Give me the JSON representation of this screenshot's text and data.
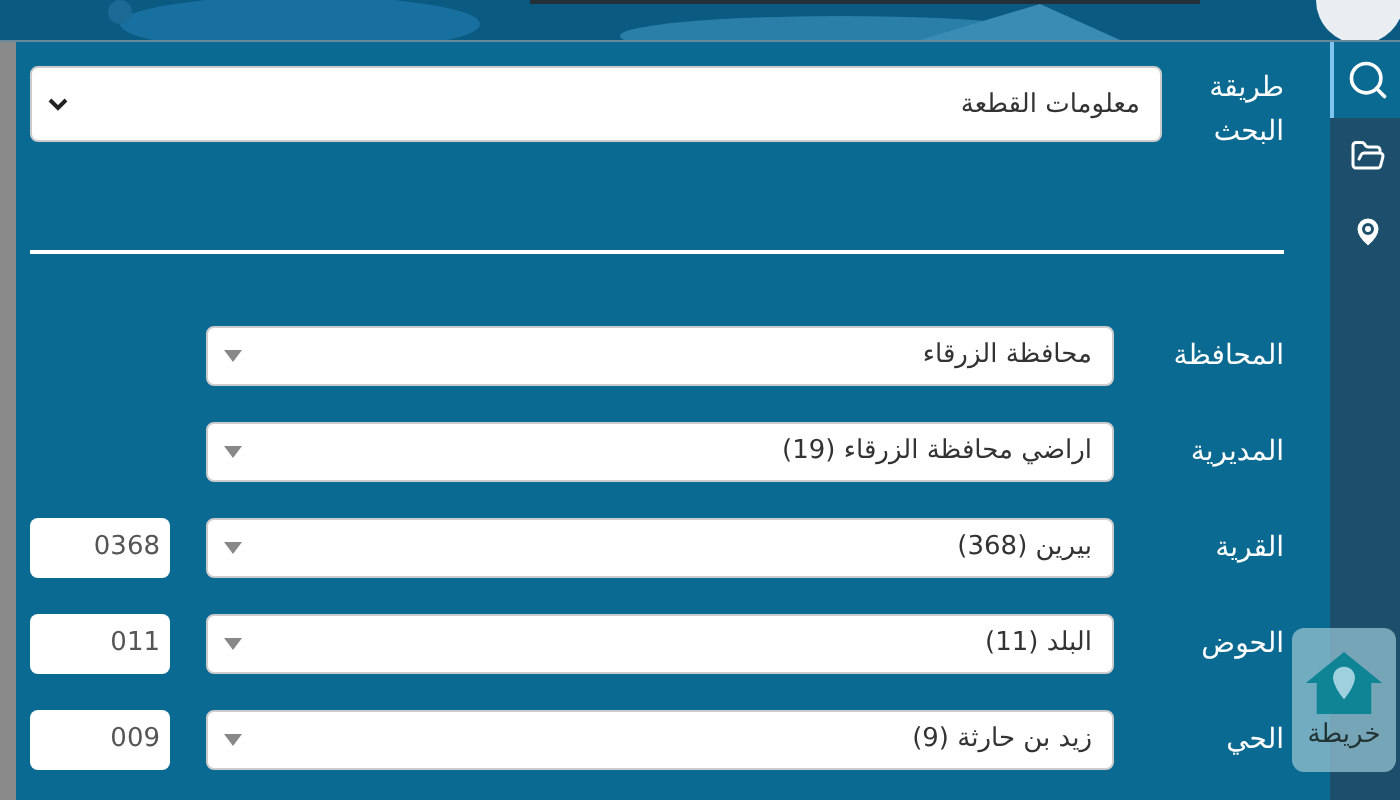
{
  "search_method": {
    "label": "طريقة البحث",
    "value": "معلومات القطعة"
  },
  "fields": [
    {
      "label": "المحافظة",
      "value": "محافظة الزرقاء"
    },
    {
      "label": "المديرية",
      "value": "اراضي محافظة الزرقاء (19)"
    },
    {
      "label": "القرية",
      "value": "بيرين (368)",
      "code": "0368"
    },
    {
      "label": "الحوض",
      "value": "البلد (11)",
      "code": "011"
    },
    {
      "label": "الحي",
      "value": "زيد بن حارثة (9)",
      "code": "009"
    }
  ],
  "sidebar": [
    {
      "kind": "search",
      "selected": true
    },
    {
      "kind": "folder",
      "selected": false
    },
    {
      "kind": "pin",
      "selected": false
    }
  ],
  "map_button": {
    "label": "خريطة"
  }
}
